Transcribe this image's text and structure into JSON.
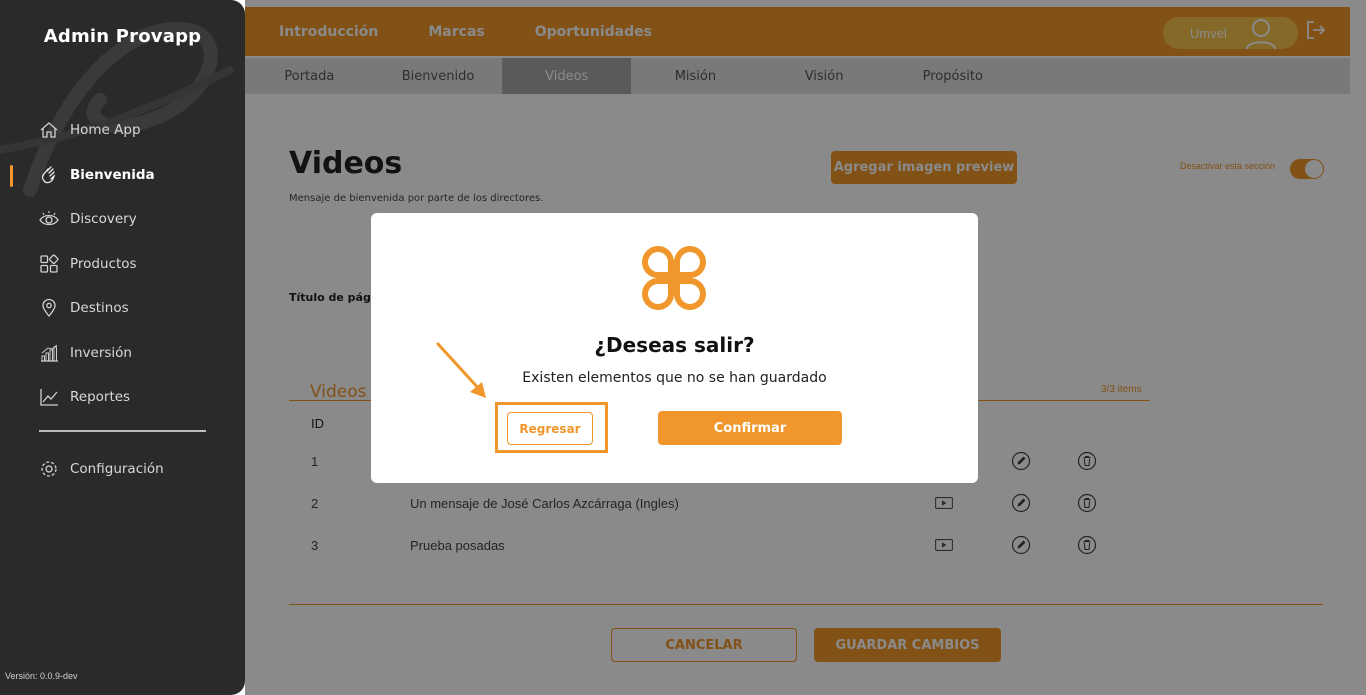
{
  "sidebar": {
    "brand": "Admin Provapp",
    "items": [
      {
        "label": "Home App",
        "icon": "home-icon"
      },
      {
        "label": "Bienvenida",
        "icon": "waving-hand-icon",
        "active": true
      },
      {
        "label": "Discovery",
        "icon": "eye-icon"
      },
      {
        "label": "Productos",
        "icon": "grid-icon"
      },
      {
        "label": "Destinos",
        "icon": "map-pin-icon"
      },
      {
        "label": "Inversión",
        "icon": "bar-chart-icon"
      },
      {
        "label": "Reportes",
        "icon": "line-chart-icon"
      }
    ],
    "config_label": "Configuración",
    "config_icon": "gear-icon",
    "version": "Versión: 0.0.9-dev"
  },
  "topbar": {
    "tabs": [
      "Introducción",
      "Marcas",
      "Oportunidades"
    ],
    "user_name": "Umvel"
  },
  "subtabs": {
    "items": [
      "Portada",
      "Bienvenido",
      "Videos",
      "Misión",
      "Visión",
      "Propósito"
    ],
    "active_index": 2
  },
  "main": {
    "title": "Videos",
    "subtitle": "Mensaje de bienvenida por parte de los directores.",
    "preview_button": "Agregar imagen preview",
    "toggle_label": "Desactivar esta sección",
    "toggle_on": true,
    "field_label": "Título de pági",
    "section_title": "Videos",
    "section_count": "3/3 items",
    "column_id": "ID",
    "rows": [
      {
        "id": "1",
        "name": ""
      },
      {
        "id": "2",
        "name": "Un mensaje de José Carlos Azcárraga (Ingles)"
      },
      {
        "id": "3",
        "name": "Prueba posadas"
      }
    ],
    "cancel_button": "CANCELAR",
    "save_button": "GUARDAR CAMBIOS"
  },
  "modal": {
    "title": "¿Deseas salir?",
    "message": "Existen elementos que no se han guardado",
    "back_button": "Regresar",
    "confirm_button": "Confirmar"
  },
  "colors": {
    "accent": "#f0962a",
    "sidebar_bg": "#2a2a2a",
    "subtab_active": "#a6a6a6",
    "user_pill": "#f6c24c"
  }
}
